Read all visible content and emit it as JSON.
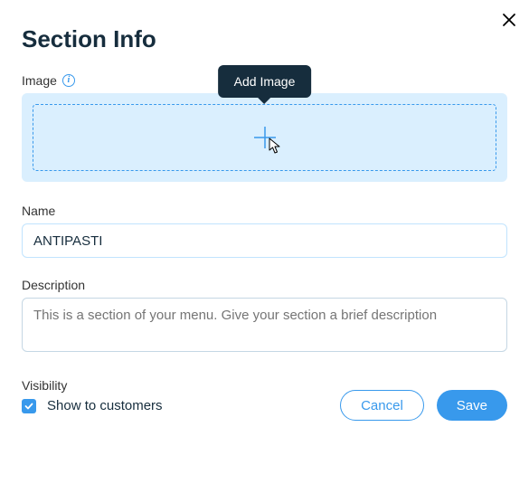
{
  "dialog": {
    "title": "Section Info",
    "image_field_label": "Image",
    "tooltip_text": "Add Image",
    "name_field_label": "Name",
    "name_value": "ANTIPASTI",
    "description_field_label": "Description",
    "description_placeholder": "This is a section of your menu. Give your section a brief description",
    "visibility_field_label": "Visibility",
    "visibility_checkbox_label": "Show to customers",
    "visibility_checked": true,
    "cancel_label": "Cancel",
    "save_label": "Save"
  },
  "colors": {
    "accent": "#3899ec",
    "tooltip_bg": "#162d3d",
    "dropzone_bg": "#daeffe"
  }
}
